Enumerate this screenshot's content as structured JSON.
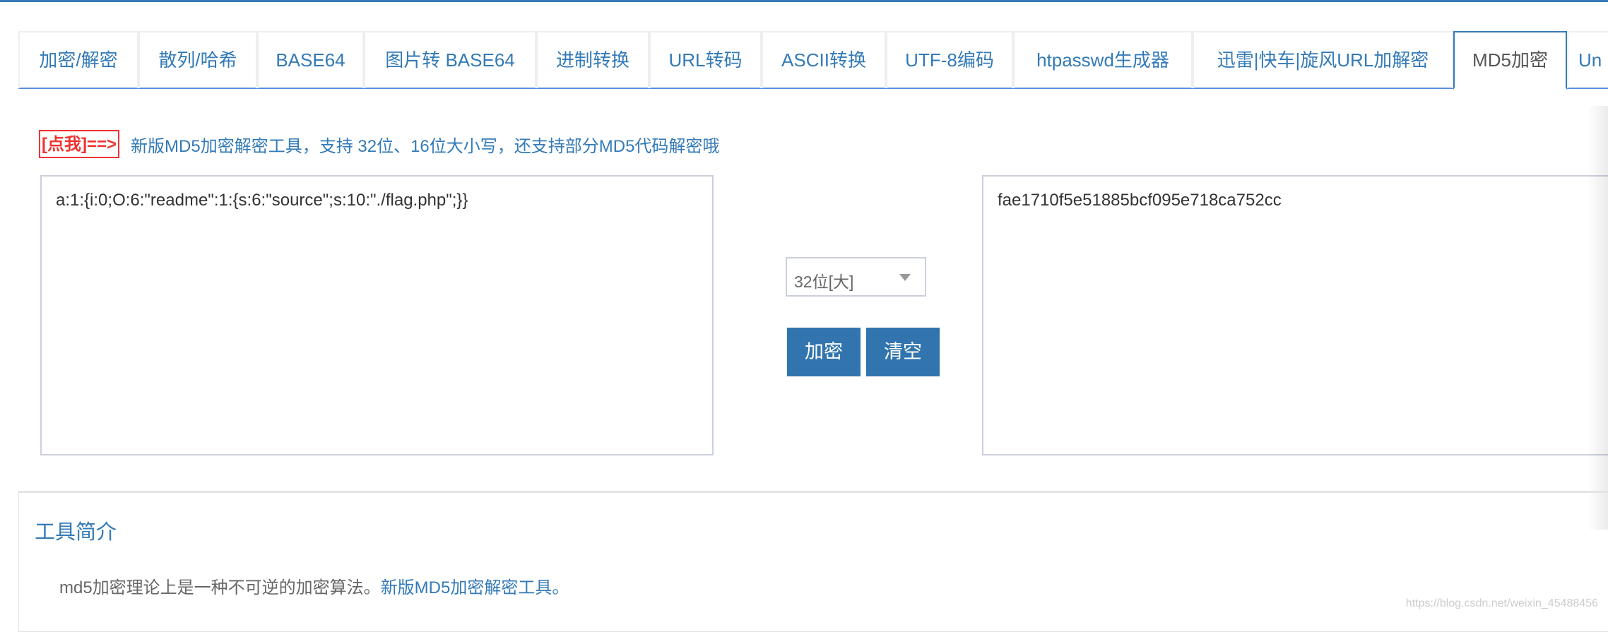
{
  "tabs": [
    "加密/解密",
    "散列/哈希",
    "BASE64",
    "图片转 BASE64",
    "进制转换",
    "URL转码",
    "ASCII转换",
    "UTF-8编码",
    "htpasswd生成器",
    "迅雷|快车|旋风URL加解密",
    "MD5加密",
    "Un"
  ],
  "active_tab": "MD5加密",
  "promo": {
    "badge": "[点我]==>",
    "link": "新版MD5加密解密工具，支持 32位、16位大小写，还支持部分MD5代码解密哦"
  },
  "input_text": "a:1:{i:0;O:6:\"readme\":1:{s:6:\"source\";s:10:\"./flag.php\";}}",
  "output_text": "fae1710f5e51885bcf095e718ca752cc",
  "select_value": "32位[大]",
  "buttons": {
    "encrypt": "加密",
    "clear": "清空"
  },
  "intro": {
    "title": "工具简介",
    "text": "md5加密理论上是一种不可逆的加密算法。",
    "link": "新版MD5加密解密工具。"
  },
  "watermark": "https://blog.csdn.net/weixin_45488456",
  "colors": {
    "accent": "#337ab7",
    "button": "#3174ae",
    "badge": "#ee3333"
  }
}
